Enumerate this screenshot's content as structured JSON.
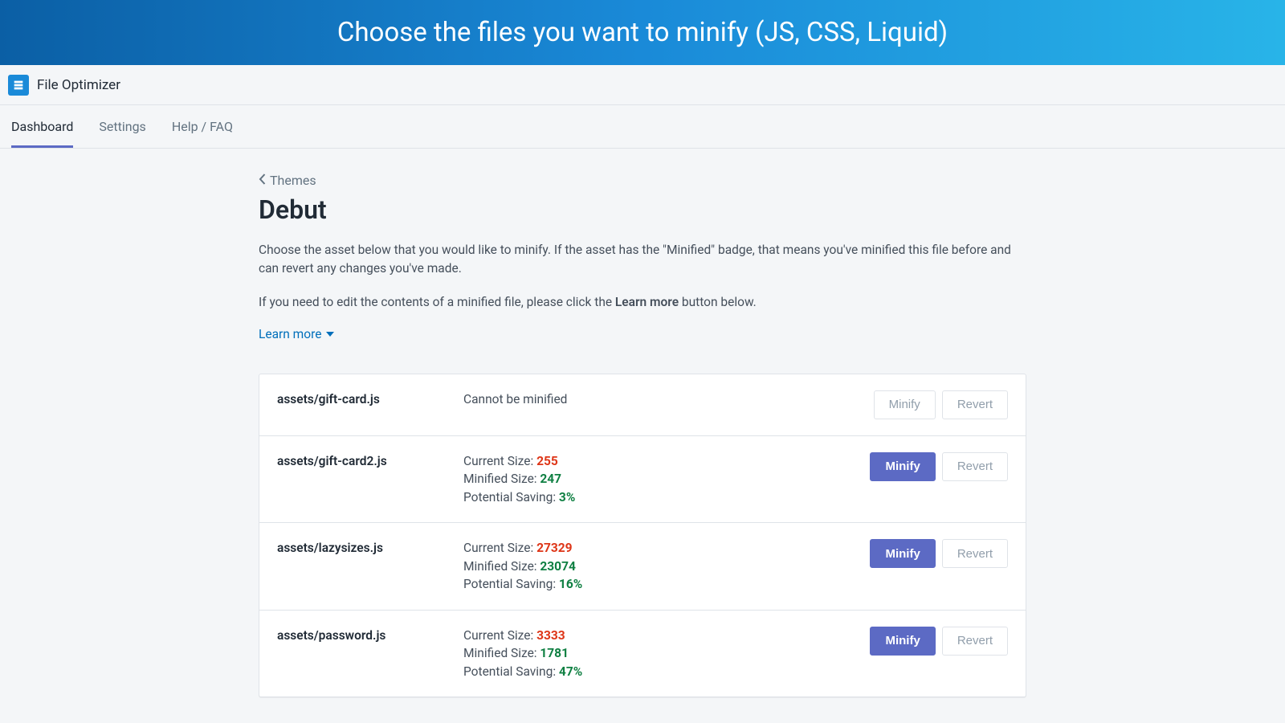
{
  "banner": {
    "headline": "Choose the files you want to minify (JS, CSS, Liquid)"
  },
  "app": {
    "title": "File Optimizer"
  },
  "tabs": [
    {
      "label": "Dashboard",
      "active": true
    },
    {
      "label": "Settings",
      "active": false
    },
    {
      "label": "Help / FAQ",
      "active": false
    }
  ],
  "breadcrumb": {
    "label": "Themes"
  },
  "page_title": "Debut",
  "intro_paragraph": "Choose the asset below that you would like to minify. If the asset has the \"Minified\" badge, that means you've minified this file before and can revert any changes you've made.",
  "intro_paragraph2_pre": "If you need to edit the contents of a minified file, please click the ",
  "intro_paragraph2_bold": "Learn more",
  "intro_paragraph2_post": " button below.",
  "learn_more_label": "Learn more",
  "labels": {
    "current_size": "Current Size: ",
    "minified_size": "Minified Size: ",
    "potential_saving": "Potential Saving: ",
    "cannot_minify": "Cannot be minified",
    "minify": "Minify",
    "revert": "Revert"
  },
  "assets": [
    {
      "name": "assets/gift-card.js",
      "status": "cannot",
      "minify_enabled": false,
      "revert_enabled": false
    },
    {
      "name": "assets/gift-card2.js",
      "current_size": "255",
      "minified_size": "247",
      "saving": "3%",
      "minify_enabled": true,
      "revert_enabled": false
    },
    {
      "name": "assets/lazysizes.js",
      "current_size": "27329",
      "minified_size": "23074",
      "saving": "16%",
      "minify_enabled": true,
      "revert_enabled": false
    },
    {
      "name": "assets/password.js",
      "current_size": "3333",
      "minified_size": "1781",
      "saving": "47%",
      "minify_enabled": true,
      "revert_enabled": false
    }
  ],
  "colors": {
    "accent": "#5c6ac4",
    "link": "#006fbb",
    "danger": "#de3618",
    "success": "#108043"
  }
}
